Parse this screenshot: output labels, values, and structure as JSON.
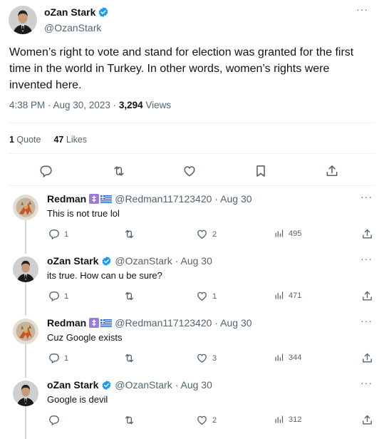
{
  "main_tweet": {
    "author": "oZan Stark",
    "handle": "@OzanStark",
    "more_label": "···",
    "text": "Women’s right to vote and stand for election was granted for the first time in the world in Turkey. In other words, women’s rights were invented here.",
    "time": "4:38 PM · Aug 30, 2023 · ",
    "views_count": "3,294",
    "views_label": " Views",
    "quotes_count": "1",
    "quotes_label": " Quote",
    "likes_count": "47",
    "likes_label": " Likes"
  },
  "replies": [
    {
      "author": "Redman",
      "handle": "@Redman117123420",
      "date": "· Aug 30",
      "text": "This is not true lol",
      "replies": "1",
      "retweets": "",
      "likes": "2",
      "views": "495",
      "verified": false,
      "flags": true
    },
    {
      "author": "oZan Stark",
      "handle": "@OzanStark",
      "date": "· Aug 30",
      "text": "its true. How can u be sure?",
      "replies": "1",
      "retweets": "",
      "likes": "1",
      "views": "471",
      "verified": true,
      "flags": false
    },
    {
      "author": "Redman",
      "handle": "@Redman117123420",
      "date": "· Aug 30",
      "text": "Cuz Google exists",
      "replies": "1",
      "retweets": "",
      "likes": "3",
      "views": "344",
      "verified": false,
      "flags": true
    },
    {
      "author": "oZan Stark",
      "handle": "@OzanStark",
      "date": "· Aug 30",
      "text": "Google is devil",
      "replies": "",
      "retweets": "",
      "likes": "2",
      "views": "312",
      "verified": true,
      "flags": false
    }
  ],
  "more_label": "···",
  "icons": {
    "reply": "reply-icon",
    "retweet": "retweet-icon",
    "like": "like-icon",
    "bookmark": "bookmark-icon",
    "share": "share-icon",
    "views": "views-icon",
    "verified": "verified-badge-icon"
  },
  "colors": {
    "text": "#0f1419",
    "muted": "#536471",
    "verified": "#1d9bf0",
    "border": "#eff3f4",
    "thread_line": "#cfd9de"
  }
}
